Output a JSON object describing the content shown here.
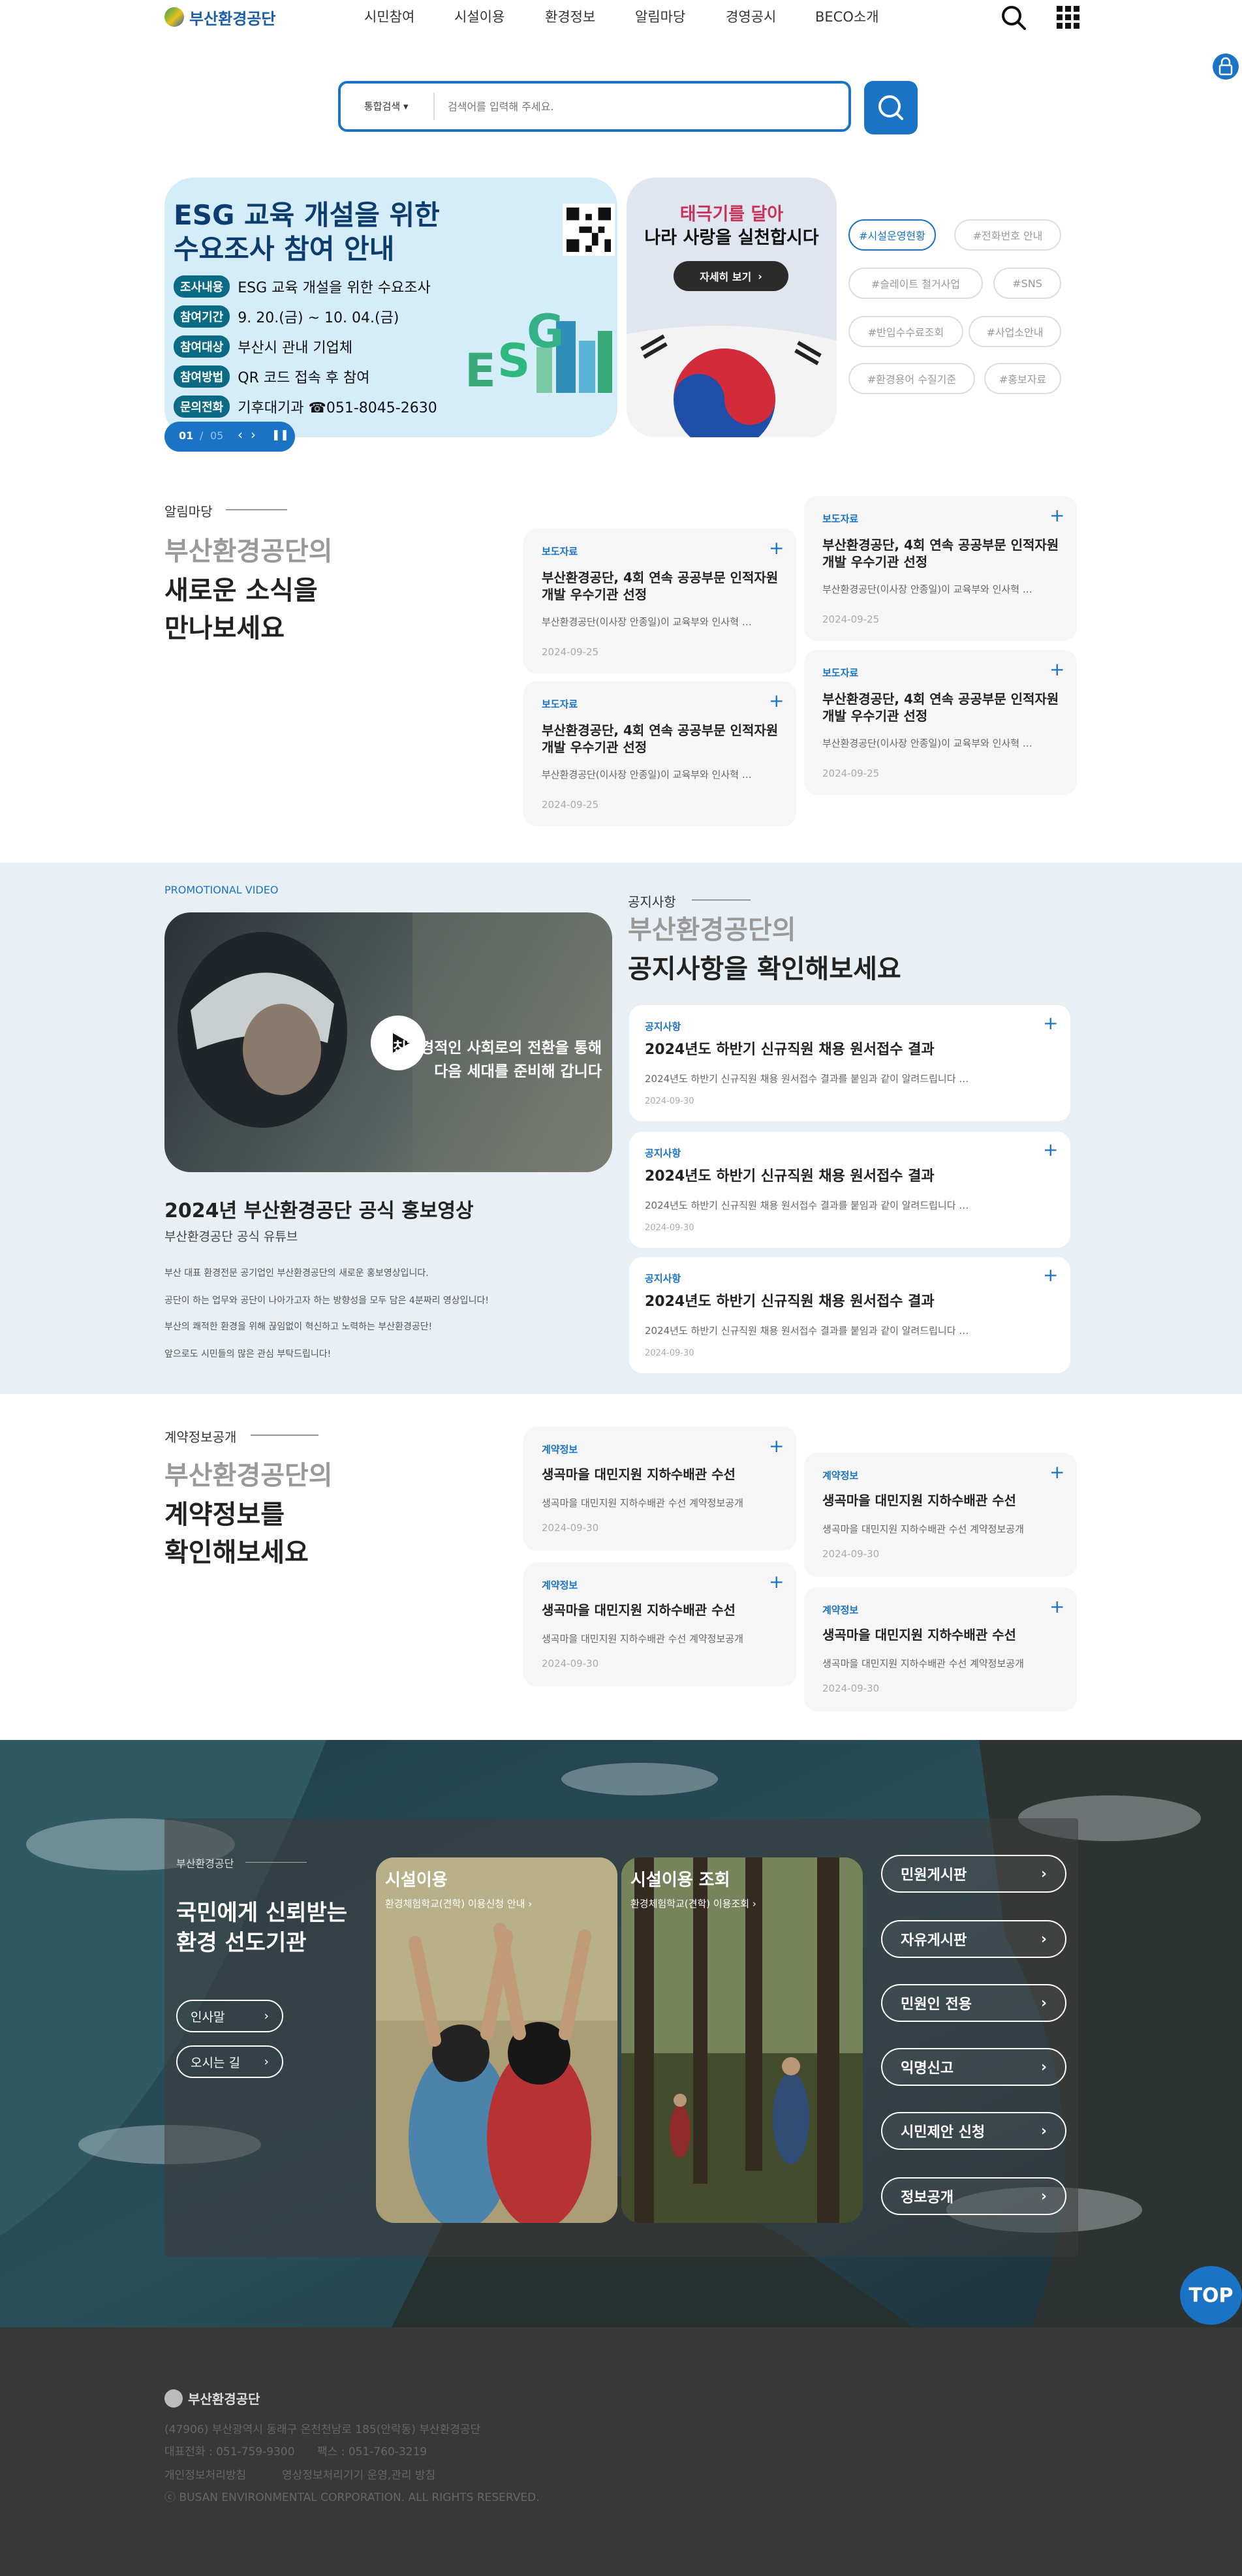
{
  "header": {
    "logo": "부산환경공단",
    "nav": [
      "시민참여",
      "시설이용",
      "환경정보",
      "알림마당",
      "경영공시",
      "BECO소개"
    ]
  },
  "search": {
    "category": "통합검색",
    "placeholder": "검색어를 입력해 주세요."
  },
  "banner": {
    "title": "ESG 교육 개설을 위한 수요조사 참여 안내",
    "rows": [
      {
        "tag": "조사내용",
        "value": "ESG 교육 개설을 위한 수요조사"
      },
      {
        "tag": "참여기간",
        "value": "9. 20.(금) ~ 10. 04.(금)"
      },
      {
        "tag": "참여대상",
        "value": "부산시 관내 기업체"
      },
      {
        "tag": "참여방법",
        "value": "QR 코드 접속 후 참여"
      },
      {
        "tag": "문의전화",
        "value": "기후대기과 ☎051-8045-2630"
      }
    ],
    "counter_current": "01",
    "counter_sep": "/",
    "counter_total": "05"
  },
  "flag_banner": {
    "title1": "태극기를 달아",
    "title2": "나라 사랑을 실천합시다",
    "button": "자세히 보기"
  },
  "tags": [
    "#시설운영현황",
    "#전화번호 안내",
    "#슬레이트 철거사업",
    "#SNS",
    "#반입수수료조회",
    "#사업소안내",
    "#환경용어 수질기준",
    "#홍보자료"
  ],
  "news": {
    "label": "알림마당",
    "title_gray": "부산환경공단의",
    "title_dark1": "새로운 소식을",
    "title_dark2": "만나보세요",
    "cards": [
      {
        "cat": "보도자료",
        "title": "부산환경공단, 4회 연속 공공부문 인적자원 개발 우수기관 선정",
        "desc": "부산환경공단(이사장 안종일)이 교육부와 인사혁 …",
        "date": "2024-09-25"
      },
      {
        "cat": "보도자료",
        "title": "부산환경공단, 4회 연속 공공부문 인적자원 개발 우수기관 선정",
        "desc": "부산환경공단(이사장 안종일)이 교육부와 인사혁 …",
        "date": "2024-09-25"
      },
      {
        "cat": "보도자료",
        "title": "부산환경공단, 4회 연속 공공부문 인적자원 개발 우수기관 선정",
        "desc": "부산환경공단(이사장 안종일)이 교육부와 인사혁 …",
        "date": "2024-09-25"
      },
      {
        "cat": "보도자료",
        "title": "부산환경공단, 4회 연속 공공부문 인적자원 개발 우수기관 선정",
        "desc": "부산환경공단(이사장 안종일)이 교육부와 인사혁 …",
        "date": "2024-09-25"
      }
    ]
  },
  "promo": {
    "label": "PROMOTIONAL VIDEO",
    "video_caption1": "친환경적인 사회로의 전환을 통해",
    "video_caption2": "다음 세대를 준비해 갑니다",
    "title": "2024년 부산환경공단 공식 홍보영상",
    "subtitle": "부산환경공단 공식 유튜브",
    "desc": [
      "부산 대표 환경전문 공기업인 부산환경공단의 새로운 홍보영상입니다.",
      "공단이 하는 업무와 공단이 나아가고자 하는 방향성을 모두 담은 4분짜리 영상입니다!",
      "부산의 쾌적한 환경을 위해 끊임없이 혁신하고 노력하는 부산환경공단!",
      "앞으로도 시민들의 많은 관심 부탁드립니다!"
    ]
  },
  "notice": {
    "label": "공지사항",
    "title_gray": "부산환경공단의",
    "title_dark": "공지사항을 확인해보세요",
    "cards": [
      {
        "cat": "공지사항",
        "title": "2024년도 하반기 신규직원 채용 원서접수 결과",
        "desc": "2024년도 하반기 신규직원 채용 원서접수 결과를 붙임과 같이 알려드립니다 …",
        "date": "2024-09-30"
      },
      {
        "cat": "공지사항",
        "title": "2024년도 하반기 신규직원 채용 원서접수 결과",
        "desc": "2024년도 하반기 신규직원 채용 원서접수 결과를 붙임과 같이 알려드립니다 …",
        "date": "2024-09-30"
      },
      {
        "cat": "공지사항",
        "title": "2024년도 하반기 신규직원 채용 원서접수 결과",
        "desc": "2024년도 하반기 신규직원 채용 원서접수 결과를 붙임과 같이 알려드립니다 …",
        "date": "2024-09-30"
      }
    ]
  },
  "contract": {
    "label": "계약정보공개",
    "title_gray": "부산환경공단의",
    "title_dark1": "계약정보를",
    "title_dark2": "확인해보세요",
    "cards": [
      {
        "cat": "계약정보",
        "title": "생곡마을 대민지원 지하수배관 수선",
        "desc": "생곡마을 대민지원 지하수배관 수선 계약정보공개",
        "date": "2024-09-30"
      },
      {
        "cat": "계약정보",
        "title": "생곡마을 대민지원 지하수배관 수선",
        "desc": "생곡마을 대민지원 지하수배관 수선 계약정보공개",
        "date": "2024-09-30"
      },
      {
        "cat": "계약정보",
        "title": "생곡마을 대민지원 지하수배관 수선",
        "desc": "생곡마을 대민지원 지하수배관 수선 계약정보공개",
        "date": "2024-09-30"
      },
      {
        "cat": "계약정보",
        "title": "생곡마을 대민지원 지하수배관 수선",
        "desc": "생곡마을 대민지원 지하수배관 수선 계약정보공개",
        "date": "2024-09-30"
      }
    ]
  },
  "about": {
    "label": "부산환경공단",
    "slogan1": "국민에게 신뢰받는",
    "slogan2": "환경 선도기관",
    "btn_greeting": "인사말",
    "btn_directions": "오시는 길",
    "card1_title": "시설이용",
    "card1_link": "환경체험학교(견학) 이용신청 안내",
    "card2_title": "시설이용 조회",
    "card2_link": "환경체험학교(견학) 이용조회",
    "quick": [
      "민원게시판",
      "자유게시판",
      "민원인 전용",
      "익명신고",
      "시민제안 신청",
      "정보공개"
    ]
  },
  "top_button": "TOP",
  "footer": {
    "logo": "부산환경공단",
    "address": "(47906) 부산광역시 동래구 온천천남로 185(안락동) 부산환경공단",
    "phone": "대표전화 : 051-759-9300",
    "fax": "팩스 : 051-760-3219",
    "privacy": "개인정보처리방침",
    "video_policy": "영상정보처리기기 운영,관리 방침",
    "copyright": "ⓒ BUSAN ENVIRONMENTAL CORPORATION. ALL RIGHTS RESERVED."
  },
  "colors": {
    "brand": "#1a73c4",
    "promo_bg": "#e8f0f5",
    "footer_bg": "#383838"
  }
}
